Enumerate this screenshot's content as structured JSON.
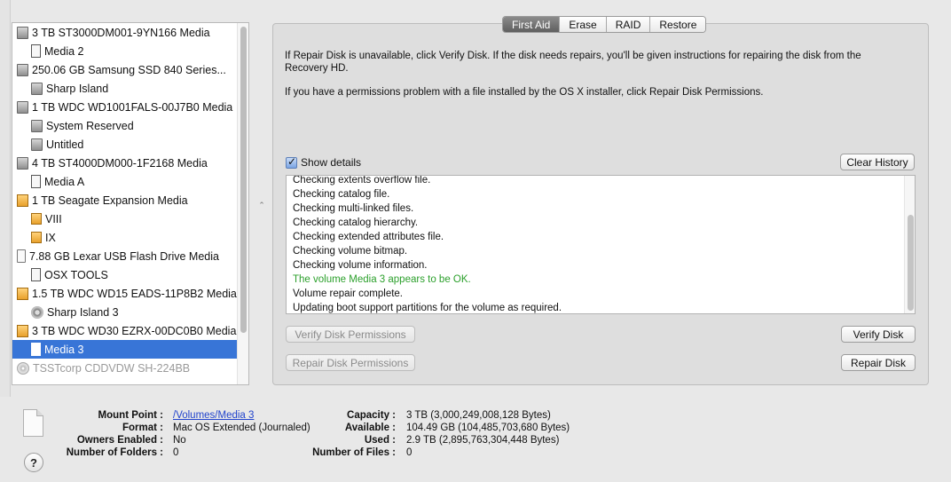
{
  "sidebar": {
    "items": [
      {
        "label": "3 TB ST3000DM001-9YN166 Media",
        "icon": "hard-disk-icon",
        "level": 0
      },
      {
        "label": "Media 2",
        "icon": "volume-icon",
        "level": 1
      },
      {
        "label": "250.06 GB Samsung SSD 840 Series...",
        "icon": "hard-disk-icon",
        "level": 0
      },
      {
        "label": "Sharp Island",
        "icon": "hard-disk-volume-icon",
        "level": 1
      },
      {
        "label": "1 TB WDC WD1001FALS-00J7B0 Media",
        "icon": "hard-disk-icon",
        "level": 0
      },
      {
        "label": "System Reserved",
        "icon": "hard-disk-volume-icon",
        "level": 1
      },
      {
        "label": "Untitled",
        "icon": "hard-disk-volume-icon",
        "level": 1
      },
      {
        "label": "4 TB ST4000DM000-1F2168 Media",
        "icon": "hard-disk-icon",
        "level": 0
      },
      {
        "label": "Media A",
        "icon": "volume-icon",
        "level": 1
      },
      {
        "label": "1 TB Seagate Expansion Media",
        "icon": "external-disk-icon",
        "level": 0
      },
      {
        "label": "VIII",
        "icon": "external-volume-icon",
        "level": 1
      },
      {
        "label": "IX",
        "icon": "external-volume-icon",
        "level": 1
      },
      {
        "label": "7.88 GB Lexar USB Flash Drive Media",
        "icon": "usb-drive-icon",
        "level": 0
      },
      {
        "label": "OSX TOOLS",
        "icon": "volume-icon",
        "level": 1
      },
      {
        "label": "1.5 TB WDC WD15 EADS-11P8B2 Media",
        "icon": "external-disk-icon",
        "level": 0
      },
      {
        "label": "Sharp Island 3",
        "icon": "network-volume-icon",
        "level": 1
      },
      {
        "label": "3 TB WDC WD30 EZRX-00DC0B0 Media",
        "icon": "external-disk-icon",
        "level": 0
      },
      {
        "label": "Media 3",
        "icon": "volume-icon",
        "level": 1,
        "selected": true
      },
      {
        "label": "TSSTcorp CDDVDW SH-224BB",
        "icon": "optical-drive-icon",
        "level": 0,
        "dimmed": true
      }
    ]
  },
  "tabs": [
    "First Aid",
    "Erase",
    "RAID",
    "Restore"
  ],
  "active_tab": "First Aid",
  "info": {
    "paragraph1": "If Repair Disk is unavailable, click Verify Disk. If the disk needs repairs, you'll be given instructions for repairing the disk from the Recovery HD.",
    "paragraph2": "If you have a permissions problem with a file installed by the OS X installer, click Repair Disk Permissions."
  },
  "show_details": {
    "label": "Show details",
    "checked": true
  },
  "buttons": {
    "clear_history": "Clear History",
    "verify_permissions": "Verify Disk Permissions",
    "repair_permissions": "Repair Disk Permissions",
    "verify_disk": "Verify Disk",
    "repair_disk": "Repair Disk"
  },
  "log": [
    {
      "text": "Checking extents overflow file.",
      "status": "normal"
    },
    {
      "text": "Checking catalog file.",
      "status": "normal"
    },
    {
      "text": "Checking multi-linked files.",
      "status": "normal"
    },
    {
      "text": "Checking catalog hierarchy.",
      "status": "normal"
    },
    {
      "text": "Checking extended attributes file.",
      "status": "normal"
    },
    {
      "text": "Checking volume bitmap.",
      "status": "normal"
    },
    {
      "text": "Checking volume information.",
      "status": "normal"
    },
    {
      "text": "The volume Media 3 appears to be OK.",
      "status": "ok"
    },
    {
      "text": "Volume repair complete.",
      "status": "normal"
    },
    {
      "text": "Updating boot support partitions for the volume as required.",
      "status": "normal"
    }
  ],
  "colors": {
    "ok": "#2ca02c",
    "selection": "#3875d7",
    "link": "#2244cc"
  },
  "details": {
    "mount_point_label": "Mount Point :",
    "mount_point": "/Volumes/Media 3",
    "format_label": "Format :",
    "format": "Mac OS Extended (Journaled)",
    "owners_label": "Owners Enabled :",
    "owners": "No",
    "folders_label": "Number of Folders :",
    "folders": "0",
    "capacity_label": "Capacity :",
    "capacity": "3 TB (3,000,249,008,128 Bytes)",
    "available_label": "Available :",
    "available": "104.49 GB (104,485,703,680 Bytes)",
    "used_label": "Used :",
    "used": "2.9 TB (2,895,763,304,448 Bytes)",
    "files_label": "Number of Files :",
    "files": "0"
  },
  "help": "?"
}
